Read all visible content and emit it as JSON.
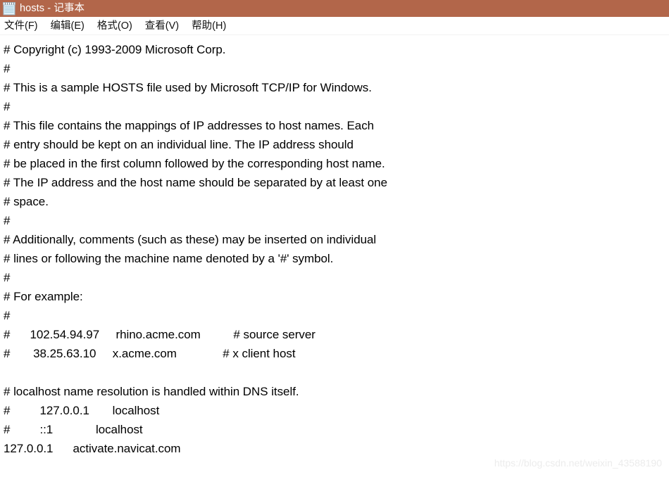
{
  "window": {
    "title": "hosts - 记事本",
    "icon_name": "notepad-icon",
    "titlebar_color": "#b2664a",
    "title_text_color": "#ffffff"
  },
  "menubar": {
    "items": [
      {
        "label": "文件(F)",
        "name": "menu-file"
      },
      {
        "label": "编辑(E)",
        "name": "menu-edit"
      },
      {
        "label": "格式(O)",
        "name": "menu-format"
      },
      {
        "label": "查看(V)",
        "name": "menu-view"
      },
      {
        "label": "帮助(H)",
        "name": "menu-help"
      }
    ]
  },
  "editor": {
    "lines": [
      "# Copyright (c) 1993-2009 Microsoft Corp.",
      "#",
      "# This is a sample HOSTS file used by Microsoft TCP/IP for Windows.",
      "#",
      "# This file contains the mappings of IP addresses to host names. Each",
      "# entry should be kept on an individual line. The IP address should",
      "# be placed in the first column followed by the corresponding host name.",
      "# The IP address and the host name should be separated by at least one",
      "# space.",
      "#",
      "# Additionally, comments (such as these) may be inserted on individual",
      "# lines or following the machine name denoted by a '#' symbol.",
      "#",
      "# For example:",
      "#",
      "#      102.54.94.97     rhino.acme.com          # source server",
      "#       38.25.63.10     x.acme.com              # x client host",
      "",
      "# localhost name resolution is handled within DNS itself.",
      "#         127.0.0.1       localhost",
      "#         ::1             localhost",
      "127.0.0.1      activate.navicat.com"
    ]
  },
  "watermark": {
    "text": "https://blog.csdn.net/weixin_43588190",
    "color": "#ececec"
  }
}
